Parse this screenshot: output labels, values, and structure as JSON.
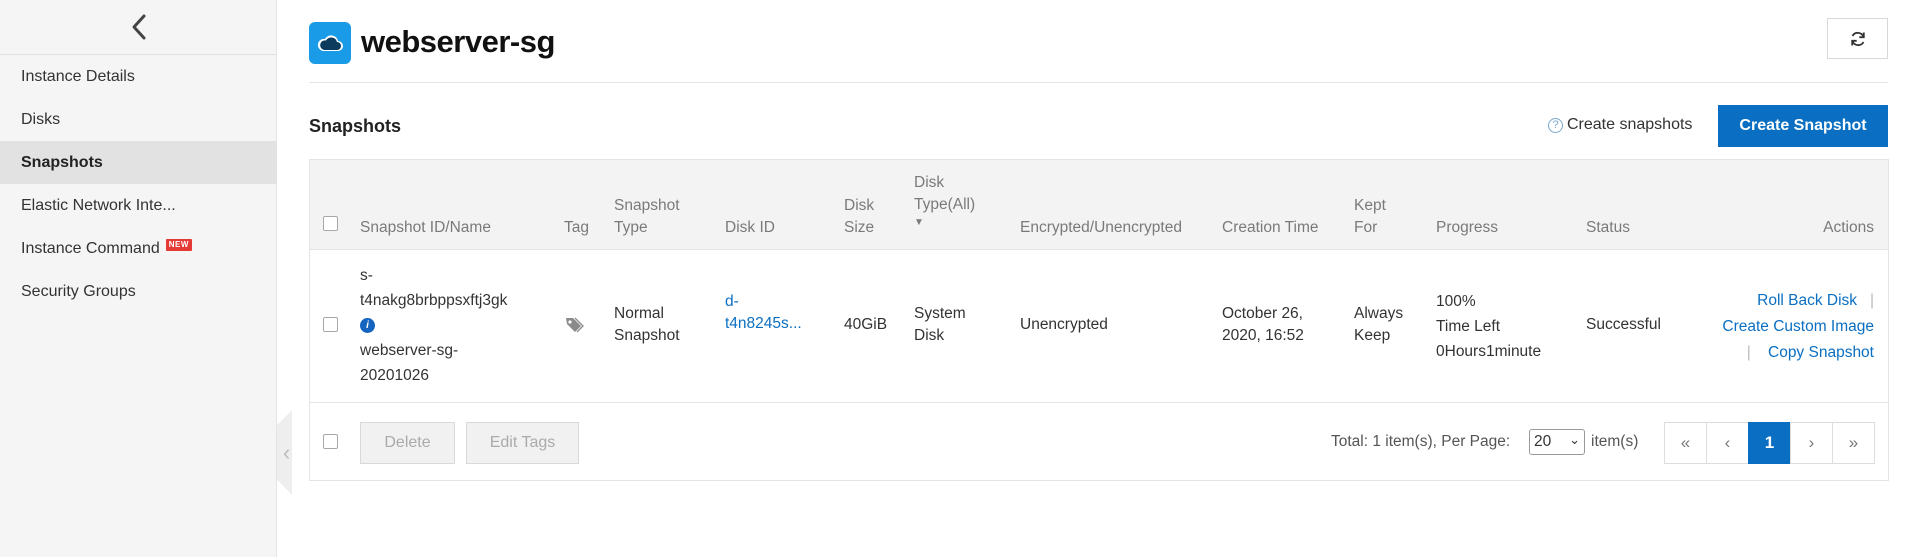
{
  "sidebar": {
    "items": [
      {
        "label": "Instance Details"
      },
      {
        "label": "Disks"
      },
      {
        "label": "Snapshots",
        "active": true
      },
      {
        "label": "Elastic Network Inte..."
      },
      {
        "label": "Instance Command",
        "badge": "NEW"
      },
      {
        "label": "Security Groups"
      }
    ]
  },
  "header": {
    "title": "webserver-sg",
    "title_icon": "cloud-icon",
    "refresh_icon": "refresh-icon"
  },
  "section": {
    "title": "Snapshots",
    "help_link": "Create snapshots",
    "create_button": "Create Snapshot"
  },
  "table": {
    "columns": {
      "id": "Snapshot ID/Name",
      "tag": "Tag",
      "type": [
        "Snapshot",
        "Type"
      ],
      "disk_id": "Disk ID",
      "disk_size": [
        "Disk",
        "Size"
      ],
      "disk_type": [
        "Disk",
        "Type(All)"
      ],
      "encrypted": "Encrypted/Unencrypted",
      "created": "Creation Time",
      "kept": [
        "Kept",
        "For"
      ],
      "progress": "Progress",
      "status": "Status",
      "actions": "Actions"
    },
    "rows": [
      {
        "id_lines": [
          "s-",
          "t4nakg8brbppsxftj3gk"
        ],
        "name_lines": [
          "webserver-sg-",
          "20201026"
        ],
        "type": [
          "Normal",
          "Snapshot"
        ],
        "disk_id": [
          "d-",
          "t4n8245s..."
        ],
        "disk_size": "40GiB",
        "disk_type": [
          "System",
          "Disk"
        ],
        "encrypted": "Unencrypted",
        "created": [
          "October 26,",
          "2020, 16:52"
        ],
        "kept": [
          "Always",
          "Keep"
        ],
        "progress": [
          "100%",
          "Time Left",
          "0Hours1minute"
        ],
        "status": "Successful",
        "actions": [
          "Roll Back Disk",
          "Create Custom Image",
          "Copy Snapshot"
        ]
      }
    ]
  },
  "footer": {
    "delete_button": "Delete",
    "edit_tags_button": "Edit Tags",
    "total_text": "Total: 1 item(s), Per Page:",
    "per_page": "20",
    "items_suffix": "item(s)",
    "pager": {
      "first": "«",
      "prev": "‹",
      "current": "1",
      "next": "›",
      "last": "»"
    }
  },
  "colors": {
    "accent": "#0a6fc2",
    "title_icon_bg": "#1a9be8",
    "new_badge": "#e53935"
  }
}
